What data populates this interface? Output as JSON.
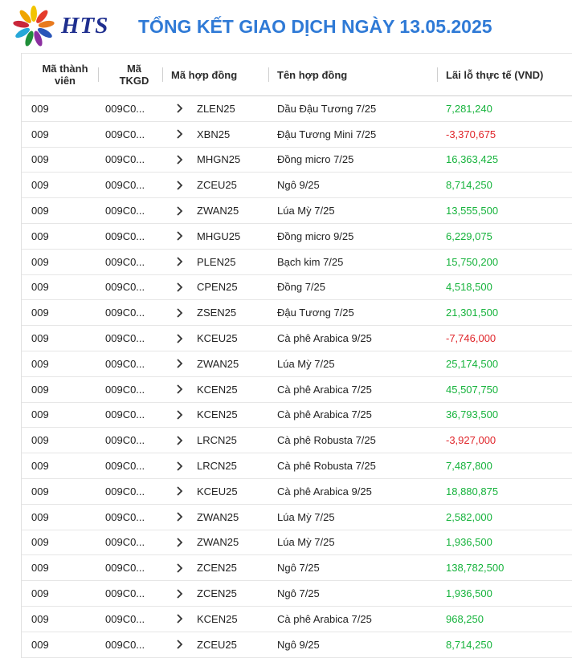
{
  "brand": {
    "logo_text": "HTS"
  },
  "page": {
    "title": "TỔNG KẾT GIAO DỊCH NGÀY 13.05.2025"
  },
  "colors": {
    "title": "#2f7ad6",
    "logo_text": "#1f2f8f",
    "positive": "#16b33c",
    "negative": "#e0262b"
  },
  "table": {
    "headers": {
      "member_l1": "Mã thành",
      "member_l2": "viên",
      "account_l1": "Mã",
      "account_l2": "TKGD",
      "contract_code": "Mã hợp đồng",
      "contract_name": "Tên hợp đồng",
      "pnl": "Lãi lỗ thực tế (VND)"
    },
    "rows": [
      {
        "member": "009",
        "account": "009C0...",
        "code": "ZLEN25",
        "name": "Dầu Đậu Tương 7/25",
        "pnl": "7,281,240",
        "sign": "pos"
      },
      {
        "member": "009",
        "account": "009C0...",
        "code": "XBN25",
        "name": "Đậu Tương Mini 7/25",
        "pnl": "-3,370,675",
        "sign": "neg"
      },
      {
        "member": "009",
        "account": "009C0...",
        "code": "MHGN25",
        "name": "Đồng micro 7/25",
        "pnl": "16,363,425",
        "sign": "pos"
      },
      {
        "member": "009",
        "account": "009C0...",
        "code": "ZCEU25",
        "name": "Ngô 9/25",
        "pnl": "8,714,250",
        "sign": "pos"
      },
      {
        "member": "009",
        "account": "009C0...",
        "code": "ZWAN25",
        "name": "Lúa Mỳ 7/25",
        "pnl": "13,555,500",
        "sign": "pos"
      },
      {
        "member": "009",
        "account": "009C0...",
        "code": "MHGU25",
        "name": "Đồng micro 9/25",
        "pnl": "6,229,075",
        "sign": "pos"
      },
      {
        "member": "009",
        "account": "009C0...",
        "code": "PLEN25",
        "name": "Bạch kim 7/25",
        "pnl": "15,750,200",
        "sign": "pos"
      },
      {
        "member": "009",
        "account": "009C0...",
        "code": "CPEN25",
        "name": "Đồng 7/25",
        "pnl": "4,518,500",
        "sign": "pos"
      },
      {
        "member": "009",
        "account": "009C0...",
        "code": "ZSEN25",
        "name": "Đậu Tương 7/25",
        "pnl": "21,301,500",
        "sign": "pos"
      },
      {
        "member": "009",
        "account": "009C0...",
        "code": "KCEU25",
        "name": "Cà phê Arabica 9/25",
        "pnl": "-7,746,000",
        "sign": "neg"
      },
      {
        "member": "009",
        "account": "009C0...",
        "code": "ZWAN25",
        "name": "Lúa Mỳ 7/25",
        "pnl": "25,174,500",
        "sign": "pos"
      },
      {
        "member": "009",
        "account": "009C0...",
        "code": "KCEN25",
        "name": "Cà phê Arabica 7/25",
        "pnl": "45,507,750",
        "sign": "pos"
      },
      {
        "member": "009",
        "account": "009C0...",
        "code": "KCEN25",
        "name": "Cà phê Arabica 7/25",
        "pnl": "36,793,500",
        "sign": "pos"
      },
      {
        "member": "009",
        "account": "009C0...",
        "code": "LRCN25",
        "name": "Cà phê Robusta 7/25",
        "pnl": "-3,927,000",
        "sign": "neg"
      },
      {
        "member": "009",
        "account": "009C0...",
        "code": "LRCN25",
        "name": "Cà phê Robusta 7/25",
        "pnl": "7,487,800",
        "sign": "pos"
      },
      {
        "member": "009",
        "account": "009C0...",
        "code": "KCEU25",
        "name": "Cà phê Arabica 9/25",
        "pnl": "18,880,875",
        "sign": "pos"
      },
      {
        "member": "009",
        "account": "009C0...",
        "code": "ZWAN25",
        "name": "Lúa Mỳ 7/25",
        "pnl": "2,582,000",
        "sign": "pos"
      },
      {
        "member": "009",
        "account": "009C0...",
        "code": "ZWAN25",
        "name": "Lúa Mỳ 7/25",
        "pnl": "1,936,500",
        "sign": "pos"
      },
      {
        "member": "009",
        "account": "009C0...",
        "code": "ZCEN25",
        "name": "Ngô 7/25",
        "pnl": "138,782,500",
        "sign": "pos"
      },
      {
        "member": "009",
        "account": "009C0...",
        "code": "ZCEN25",
        "name": "Ngô 7/25",
        "pnl": "1,936,500",
        "sign": "pos"
      },
      {
        "member": "009",
        "account": "009C0...",
        "code": "KCEN25",
        "name": "Cà phê Arabica 7/25",
        "pnl": "968,250",
        "sign": "pos"
      },
      {
        "member": "009",
        "account": "009C0...",
        "code": "ZCEU25",
        "name": "Ngô 9/25",
        "pnl": "8,714,250",
        "sign": "pos"
      }
    ]
  }
}
